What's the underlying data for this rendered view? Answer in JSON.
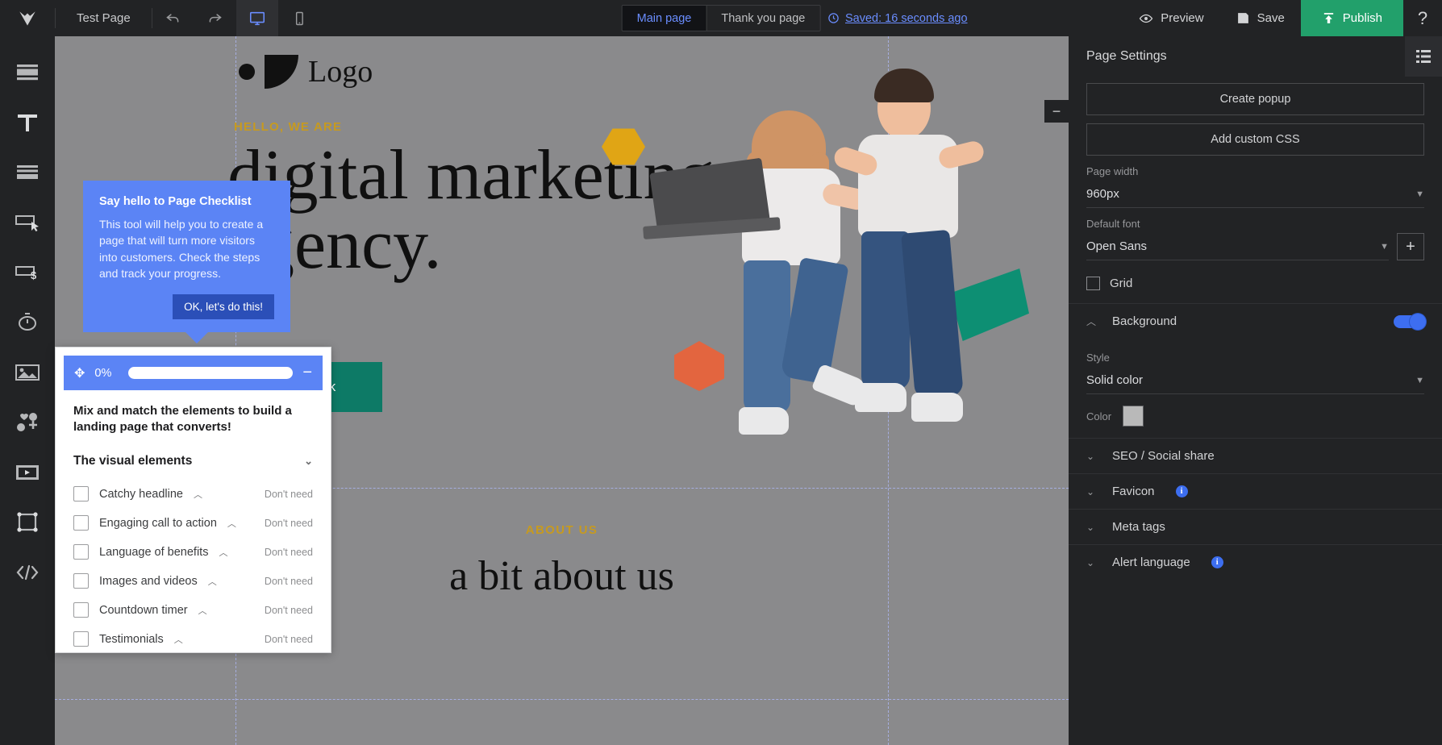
{
  "topbar": {
    "project_title": "Test Page",
    "undo_icon": "undo-icon",
    "redo_icon": "redo-icon",
    "desktop_icon": "desktop-view-icon",
    "mobile_icon": "mobile-view-icon",
    "tabs": [
      {
        "label": "Main page",
        "selected": true
      },
      {
        "label": "Thank you page",
        "selected": false
      }
    ],
    "saved_status": "Saved: 16 seconds ago",
    "saved_icon": "clock-icon",
    "preview_label": "Preview",
    "preview_icon": "eye-icon",
    "save_label": "Save",
    "save_icon": "floppy-disk-icon",
    "publish_label": "Publish",
    "publish_icon": "upload-icon",
    "help_label": "?",
    "publish_color": "#22a06b",
    "accent_color": "#6a8dff"
  },
  "left_rail": {
    "items": [
      {
        "name": "blocks-icon",
        "title": "Blocks"
      },
      {
        "name": "text-icon",
        "title": "Text"
      },
      {
        "name": "form-icon",
        "title": "Form"
      },
      {
        "name": "button-icon",
        "title": "Button"
      },
      {
        "name": "payment-button-icon",
        "title": "Payment button"
      },
      {
        "name": "timer-icon",
        "title": "Timer"
      },
      {
        "name": "image-icon",
        "title": "Image"
      },
      {
        "name": "social-icons-icon",
        "title": "Social icons"
      },
      {
        "name": "video-icon",
        "title": "Video"
      },
      {
        "name": "shape-icon",
        "title": "Shape"
      },
      {
        "name": "html-code-icon",
        "title": "HTML code"
      }
    ]
  },
  "canvas": {
    "logo_label": "Logo",
    "kicker": "HELLO, WE ARE",
    "headline": "digital marketing agency.",
    "cta_label": "Let's talk",
    "about_kicker": "ABOUT US",
    "about_heading": "a bit about us",
    "collapse_label": "−"
  },
  "tooltip": {
    "title": "Say hello to Page Checklist",
    "body": "This tool will help you to create a page that will turn more visitors into customers. Check the steps and track your progress.",
    "button_label": "OK, let's do this!"
  },
  "checklist": {
    "progress_label": "0%",
    "progress_value": 0,
    "drag_icon": "move-handle-icon",
    "minimize_label": "−",
    "intro": "Mix and match the elements to build a landing page that converts!",
    "group_label": "The visual elements",
    "skip_label": "Don't need",
    "items": [
      {
        "label": "Catchy headline",
        "checked": false,
        "skip": "Don't need"
      },
      {
        "label": "Engaging call to action",
        "checked": false,
        "skip": "Don't need"
      },
      {
        "label": "Language of benefits",
        "checked": false,
        "skip": "Don't need"
      },
      {
        "label": "Images and videos",
        "checked": false,
        "skip": "Don't need"
      },
      {
        "label": "Countdown timer",
        "checked": false,
        "skip": "Don't need"
      },
      {
        "label": "Testimonials",
        "checked": false,
        "skip": "Don't need"
      }
    ]
  },
  "right_panel": {
    "title": "Page Settings",
    "grid_icon": "layers-list-icon",
    "create_popup_label": "Create popup",
    "add_custom_css_label": "Add custom CSS",
    "page_width_label": "Page width",
    "page_width_value": "960px",
    "default_font_label": "Default font",
    "default_font_value": "Open Sans",
    "add_font_label": "+",
    "grid_checkbox_label": "Grid",
    "grid_checked": false,
    "background": {
      "label": "Background",
      "enabled": true,
      "style_label": "Style",
      "style_value": "Solid color",
      "color_label": "Color",
      "color_value": "#b9b9b9"
    },
    "sections": [
      {
        "label": "SEO / Social share",
        "info": false
      },
      {
        "label": "Favicon",
        "info": true
      },
      {
        "label": "Meta tags",
        "info": false
      },
      {
        "label": "Alert language",
        "info": true
      }
    ]
  }
}
